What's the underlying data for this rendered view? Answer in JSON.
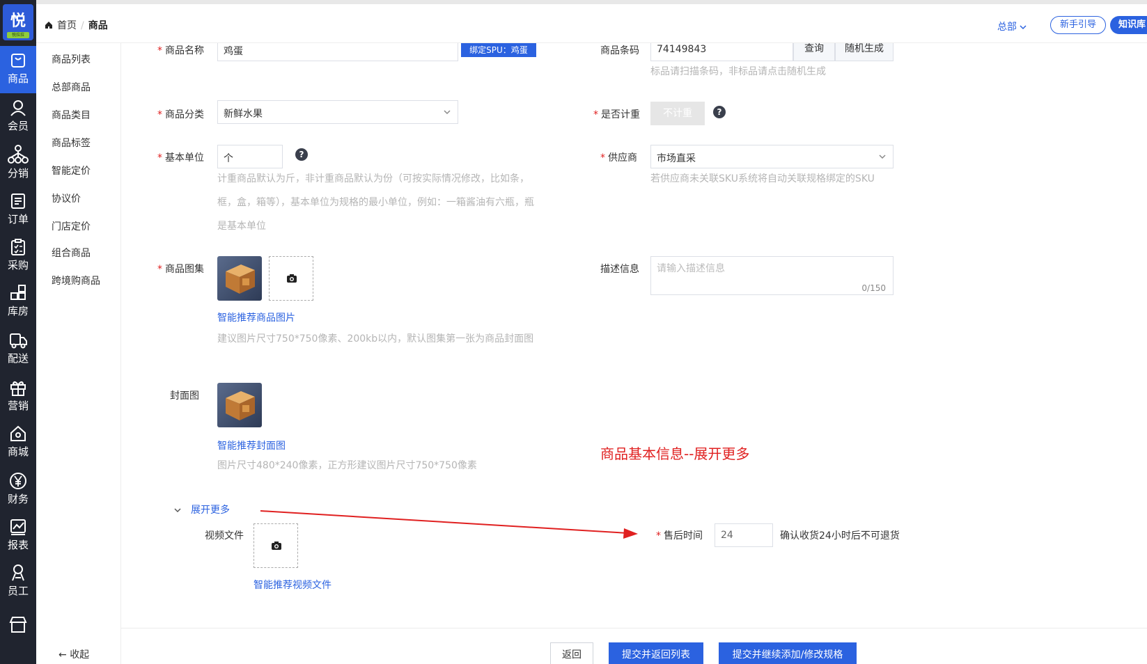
{
  "logo": {
    "char": "悦",
    "sub": "悦拉拉"
  },
  "rail": [
    {
      "label": "商品",
      "icon": "bag-icon"
    },
    {
      "label": "会员",
      "icon": "user-icon"
    },
    {
      "label": "分销",
      "icon": "network-icon"
    },
    {
      "label": "订单",
      "icon": "order-icon"
    },
    {
      "label": "采购",
      "icon": "clipboard-icon"
    },
    {
      "label": "库房",
      "icon": "warehouse-icon"
    },
    {
      "label": "配送",
      "icon": "truck-icon"
    },
    {
      "label": "营销",
      "icon": "gift-icon"
    },
    {
      "label": "商城",
      "icon": "store-icon"
    },
    {
      "label": "财务",
      "icon": "yen-icon"
    },
    {
      "label": "报表",
      "icon": "chart-icon"
    },
    {
      "label": "员工",
      "icon": "staff-icon"
    },
    {
      "label": "",
      "icon": "shop-icon"
    }
  ],
  "submenu": {
    "items": [
      "商品列表",
      "总部商品",
      "商品类目",
      "商品标签",
      "智能定价",
      "协议价",
      "门店定价",
      "组合商品",
      "跨境购商品"
    ],
    "collapse": "收起"
  },
  "header": {
    "home": "首页",
    "current": "商品",
    "hq": "总部",
    "guide": "新手引导",
    "knowledge": "知识库"
  },
  "form": {
    "name_label": "商品名称",
    "name_value": "鸡蛋",
    "spu_tag": "绑定SPU：鸡蛋",
    "barcode_label": "商品条码",
    "barcode_value": "74149843",
    "barcode_query": "查询",
    "barcode_random": "随机生成",
    "barcode_hint": "标品请扫描条码，非标品请点击随机生成",
    "category_label": "商品分类",
    "category_value": "新鲜水果",
    "weigh_label": "是否计重",
    "weigh_value": "不计重",
    "unit_label": "基本单位",
    "unit_value": "个",
    "unit_hint_1": "计重商品默认为斤，非计重商品默认为份（可按实际情况修改，比如条，",
    "unit_hint_2": "框，盒，箱等），基本单位为规格的最小单位，例如：一箱酱油有六瓶，瓶",
    "unit_hint_3": "是基本单位",
    "supplier_label": "供应商",
    "supplier_value": "市场直采",
    "supplier_hint": "若供应商未关联SKU系统将自动关联规格绑定的SKU",
    "gallery_label": "商品图集",
    "gallery_link": "智能推荐商品图片",
    "gallery_hint": "建议图片尺寸750*750像素、200kb以内，默认图集第一张为商品封面图",
    "desc_label": "描述信息",
    "desc_placeholder": "请输入描述信息",
    "desc_count": "0/150",
    "cover_label": "封面图",
    "cover_link": "智能推荐封面图",
    "cover_hint": "图片尺寸480*240像素，正方形建议图片尺寸750*750像素",
    "annotation": "商品基本信息--展开更多",
    "expand_more": "展开更多",
    "video_label": "视频文件",
    "video_link": "智能推荐视频文件",
    "aftersale_label": "售后时间",
    "aftersale_value": "24",
    "aftersale_hint": "确认收货24小时后不可退货"
  },
  "footer": {
    "back": "返回",
    "submit_return": "提交并返回列表",
    "submit_continue": "提交并继续添加/修改规格"
  },
  "colors": {
    "primary": "#2b62e0",
    "rail": "#20242f",
    "annotation": "#e02020"
  }
}
